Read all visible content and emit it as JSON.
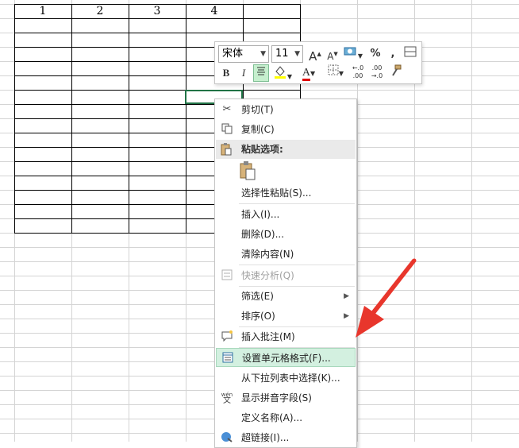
{
  "sheet": {
    "column_headers": [
      "1",
      "2",
      "3",
      "4"
    ]
  },
  "mini_toolbar": {
    "font_name": "宋体",
    "font_size": "11",
    "increase_font": "A",
    "decrease_font": "A",
    "percent": "%",
    "comma": ",",
    "bold": "B",
    "italic": "I",
    "font_color": "A",
    "highlight_color": "#ffff00",
    "font_color_value": "#e00000"
  },
  "context_menu": {
    "items": [
      {
        "label": "剪切(T)",
        "icon": "scissors-icon"
      },
      {
        "label": "复制(C)",
        "icon": "copy-icon"
      },
      {
        "label": "粘贴选项:",
        "icon": "paste-icon"
      },
      {
        "label": "选择性粘贴(S)..."
      },
      {
        "label": "插入(I)..."
      },
      {
        "label": "删除(D)..."
      },
      {
        "label": "清除内容(N)"
      },
      {
        "label": "快速分析(Q)",
        "icon": "quick-analysis-icon"
      },
      {
        "label": "筛选(E)"
      },
      {
        "label": "排序(O)"
      },
      {
        "label": "插入批注(M)",
        "icon": "comment-icon"
      },
      {
        "label": "设置单元格格式(F)...",
        "icon": "format-cells-icon"
      },
      {
        "label": "从下拉列表中选择(K)..."
      },
      {
        "label": "显示拼音字段(S)",
        "icon": "phonetic-icon"
      },
      {
        "label": "定义名称(A)..."
      },
      {
        "label": "超链接(I)...",
        "icon": "hyperlink-icon"
      }
    ],
    "phonetic_icon_text": "wén"
  },
  "colors": {
    "selection_border": "#217346",
    "highlight_bg": "#d3f0e0",
    "arrow": "#e8362c"
  }
}
